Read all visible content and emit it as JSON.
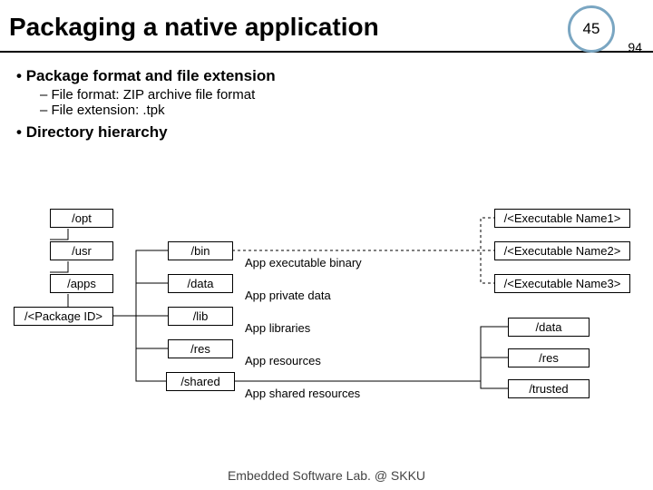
{
  "title": "Packaging a native application",
  "page_badge": "45",
  "page_sub": "94",
  "outline": {
    "b1": "Package format and file extension",
    "s1": "File format: ZIP archive file format",
    "s2": "File extension: .tpk",
    "b2": "Directory hierarchy"
  },
  "left": {
    "opt": "/opt",
    "usr": "/usr",
    "apps": "/apps",
    "pkg": "/<Package ID>"
  },
  "mid": {
    "bin": "/bin",
    "data": "/data",
    "lib": "/lib",
    "res": "/res",
    "shared": "/shared"
  },
  "midlbl": {
    "bin": "App executable binary",
    "data": "App private data",
    "lib": "App libraries",
    "res": "App resources",
    "shared": "App shared resources"
  },
  "right": {
    "ex1": "/<Executable Name1>",
    "ex2": "/<Executable Name2>",
    "ex3": "/<Executable Name3>",
    "data": "/data",
    "res": "/res",
    "trusted": "/trusted"
  },
  "footer": "Embedded Software Lab. @ SKKU"
}
